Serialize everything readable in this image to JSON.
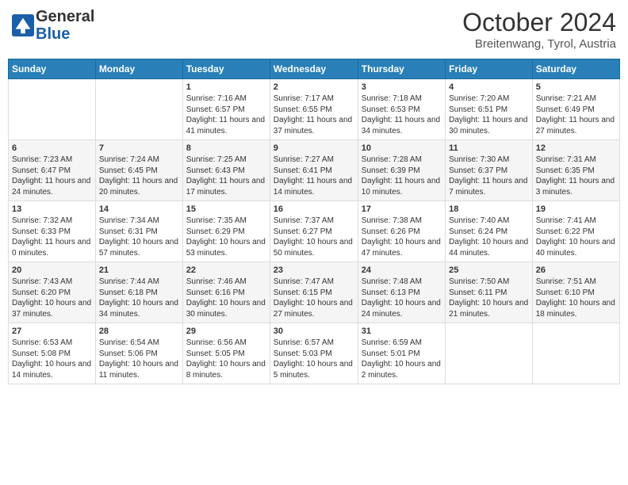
{
  "header": {
    "logo_line1": "General",
    "logo_line2": "Blue",
    "month_year": "October 2024",
    "location": "Breitenwang, Tyrol, Austria"
  },
  "days_of_week": [
    "Sunday",
    "Monday",
    "Tuesday",
    "Wednesday",
    "Thursday",
    "Friday",
    "Saturday"
  ],
  "weeks": [
    [
      {
        "day": "",
        "content": ""
      },
      {
        "day": "",
        "content": ""
      },
      {
        "day": "1",
        "content": "Sunrise: 7:16 AM\nSunset: 6:57 PM\nDaylight: 11 hours and 41 minutes."
      },
      {
        "day": "2",
        "content": "Sunrise: 7:17 AM\nSunset: 6:55 PM\nDaylight: 11 hours and 37 minutes."
      },
      {
        "day": "3",
        "content": "Sunrise: 7:18 AM\nSunset: 6:53 PM\nDaylight: 11 hours and 34 minutes."
      },
      {
        "day": "4",
        "content": "Sunrise: 7:20 AM\nSunset: 6:51 PM\nDaylight: 11 hours and 30 minutes."
      },
      {
        "day": "5",
        "content": "Sunrise: 7:21 AM\nSunset: 6:49 PM\nDaylight: 11 hours and 27 minutes."
      }
    ],
    [
      {
        "day": "6",
        "content": "Sunrise: 7:23 AM\nSunset: 6:47 PM\nDaylight: 11 hours and 24 minutes."
      },
      {
        "day": "7",
        "content": "Sunrise: 7:24 AM\nSunset: 6:45 PM\nDaylight: 11 hours and 20 minutes."
      },
      {
        "day": "8",
        "content": "Sunrise: 7:25 AM\nSunset: 6:43 PM\nDaylight: 11 hours and 17 minutes."
      },
      {
        "day": "9",
        "content": "Sunrise: 7:27 AM\nSunset: 6:41 PM\nDaylight: 11 hours and 14 minutes."
      },
      {
        "day": "10",
        "content": "Sunrise: 7:28 AM\nSunset: 6:39 PM\nDaylight: 11 hours and 10 minutes."
      },
      {
        "day": "11",
        "content": "Sunrise: 7:30 AM\nSunset: 6:37 PM\nDaylight: 11 hours and 7 minutes."
      },
      {
        "day": "12",
        "content": "Sunrise: 7:31 AM\nSunset: 6:35 PM\nDaylight: 11 hours and 3 minutes."
      }
    ],
    [
      {
        "day": "13",
        "content": "Sunrise: 7:32 AM\nSunset: 6:33 PM\nDaylight: 11 hours and 0 minutes."
      },
      {
        "day": "14",
        "content": "Sunrise: 7:34 AM\nSunset: 6:31 PM\nDaylight: 10 hours and 57 minutes."
      },
      {
        "day": "15",
        "content": "Sunrise: 7:35 AM\nSunset: 6:29 PM\nDaylight: 10 hours and 53 minutes."
      },
      {
        "day": "16",
        "content": "Sunrise: 7:37 AM\nSunset: 6:27 PM\nDaylight: 10 hours and 50 minutes."
      },
      {
        "day": "17",
        "content": "Sunrise: 7:38 AM\nSunset: 6:26 PM\nDaylight: 10 hours and 47 minutes."
      },
      {
        "day": "18",
        "content": "Sunrise: 7:40 AM\nSunset: 6:24 PM\nDaylight: 10 hours and 44 minutes."
      },
      {
        "day": "19",
        "content": "Sunrise: 7:41 AM\nSunset: 6:22 PM\nDaylight: 10 hours and 40 minutes."
      }
    ],
    [
      {
        "day": "20",
        "content": "Sunrise: 7:43 AM\nSunset: 6:20 PM\nDaylight: 10 hours and 37 minutes."
      },
      {
        "day": "21",
        "content": "Sunrise: 7:44 AM\nSunset: 6:18 PM\nDaylight: 10 hours and 34 minutes."
      },
      {
        "day": "22",
        "content": "Sunrise: 7:46 AM\nSunset: 6:16 PM\nDaylight: 10 hours and 30 minutes."
      },
      {
        "day": "23",
        "content": "Sunrise: 7:47 AM\nSunset: 6:15 PM\nDaylight: 10 hours and 27 minutes."
      },
      {
        "day": "24",
        "content": "Sunrise: 7:48 AM\nSunset: 6:13 PM\nDaylight: 10 hours and 24 minutes."
      },
      {
        "day": "25",
        "content": "Sunrise: 7:50 AM\nSunset: 6:11 PM\nDaylight: 10 hours and 21 minutes."
      },
      {
        "day": "26",
        "content": "Sunrise: 7:51 AM\nSunset: 6:10 PM\nDaylight: 10 hours and 18 minutes."
      }
    ],
    [
      {
        "day": "27",
        "content": "Sunrise: 6:53 AM\nSunset: 5:08 PM\nDaylight: 10 hours and 14 minutes."
      },
      {
        "day": "28",
        "content": "Sunrise: 6:54 AM\nSunset: 5:06 PM\nDaylight: 10 hours and 11 minutes."
      },
      {
        "day": "29",
        "content": "Sunrise: 6:56 AM\nSunset: 5:05 PM\nDaylight: 10 hours and 8 minutes."
      },
      {
        "day": "30",
        "content": "Sunrise: 6:57 AM\nSunset: 5:03 PM\nDaylight: 10 hours and 5 minutes."
      },
      {
        "day": "31",
        "content": "Sunrise: 6:59 AM\nSunset: 5:01 PM\nDaylight: 10 hours and 2 minutes."
      },
      {
        "day": "",
        "content": ""
      },
      {
        "day": "",
        "content": ""
      }
    ]
  ]
}
